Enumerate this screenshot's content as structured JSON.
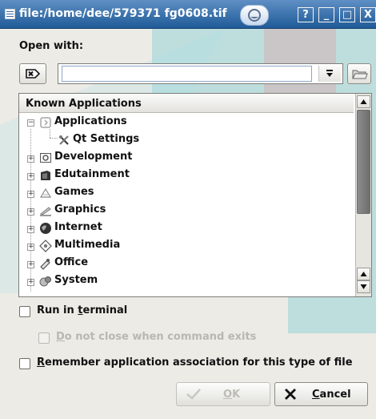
{
  "window": {
    "title": "file:/home/dee/579371 fg0608.tif",
    "buttons": {
      "help": "?",
      "minimize": "_",
      "maximize": "□",
      "close": "X"
    }
  },
  "dialog": {
    "open_with_label": "Open with:",
    "command_value": "",
    "tree": {
      "header": "Known Applications",
      "items": [
        {
          "label": "Applications",
          "level": 0,
          "expanded": true
        },
        {
          "label": "Qt Settings",
          "level": 1
        },
        {
          "label": "Development",
          "level": 0
        },
        {
          "label": "Edutainment",
          "level": 0
        },
        {
          "label": "Games",
          "level": 0
        },
        {
          "label": "Graphics",
          "level": 0
        },
        {
          "label": "Internet",
          "level": 0
        },
        {
          "label": "Multimedia",
          "level": 0
        },
        {
          "label": "Office",
          "level": 0
        },
        {
          "label": "System",
          "level": 0
        }
      ]
    },
    "run_in_terminal": {
      "before": "Run in ",
      "accel": "t",
      "after": "erminal",
      "checked": false
    },
    "do_not_close": {
      "accel": "D",
      "rest": "o not close when command exits",
      "checked": false,
      "enabled": false
    },
    "remember": {
      "accel": "R",
      "rest": "emember application association for this type of file",
      "checked": false
    },
    "ok": {
      "accel": "O",
      "rest": "K",
      "enabled": false
    },
    "cancel": {
      "accel": "C",
      "rest": "ancel"
    }
  },
  "icons": {
    "title": "document-icon",
    "clear": "clear-text-icon",
    "dropdown": "dropdown-arrow-icon",
    "browse": "folder-icon",
    "ok": "checkmark-icon",
    "cancel": "cancel-x-icon"
  }
}
